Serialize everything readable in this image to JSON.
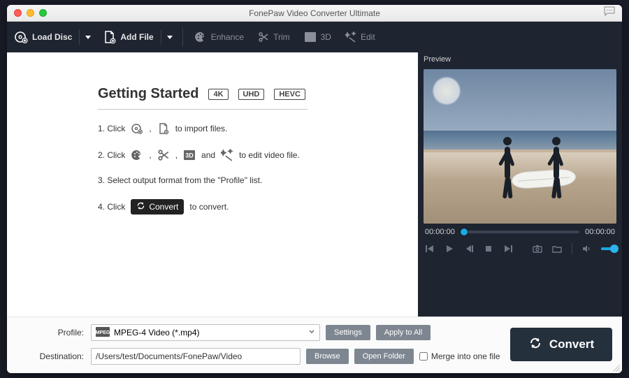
{
  "title": "FonePaw Video Converter Ultimate",
  "toolbar": {
    "load_disc": "Load Disc",
    "add_file": "Add File",
    "enhance": "Enhance",
    "trim": "Trim",
    "three_d": "3D",
    "edit": "Edit"
  },
  "getting_started": {
    "title": "Getting Started",
    "badges": [
      "4K",
      "UHD",
      "HEVC"
    ],
    "step1_a": "1. Click",
    "step1_b": "to import files.",
    "step1_sep": ",",
    "step2_a": "2. Click",
    "step2_b": "and",
    "step2_c": "to edit video file.",
    "step2_sep": ",",
    "step3": "3. Select output format from the \"Profile\" list.",
    "step4_a": "4. Click",
    "step4_b": "to convert.",
    "convert_pill": "Convert"
  },
  "preview": {
    "label": "Preview",
    "time_current": "00:00:00",
    "time_total": "00:00:00"
  },
  "bottom": {
    "profile_label": "Profile:",
    "profile_value": "MPEG-4 Video (*.mp4)",
    "settings": "Settings",
    "apply_all": "Apply to All",
    "destination_label": "Destination:",
    "destination_value": "/Users/test/Documents/FonePaw/Video",
    "browse": "Browse",
    "open_folder": "Open Folder",
    "merge": "Merge into one file",
    "convert": "Convert"
  }
}
